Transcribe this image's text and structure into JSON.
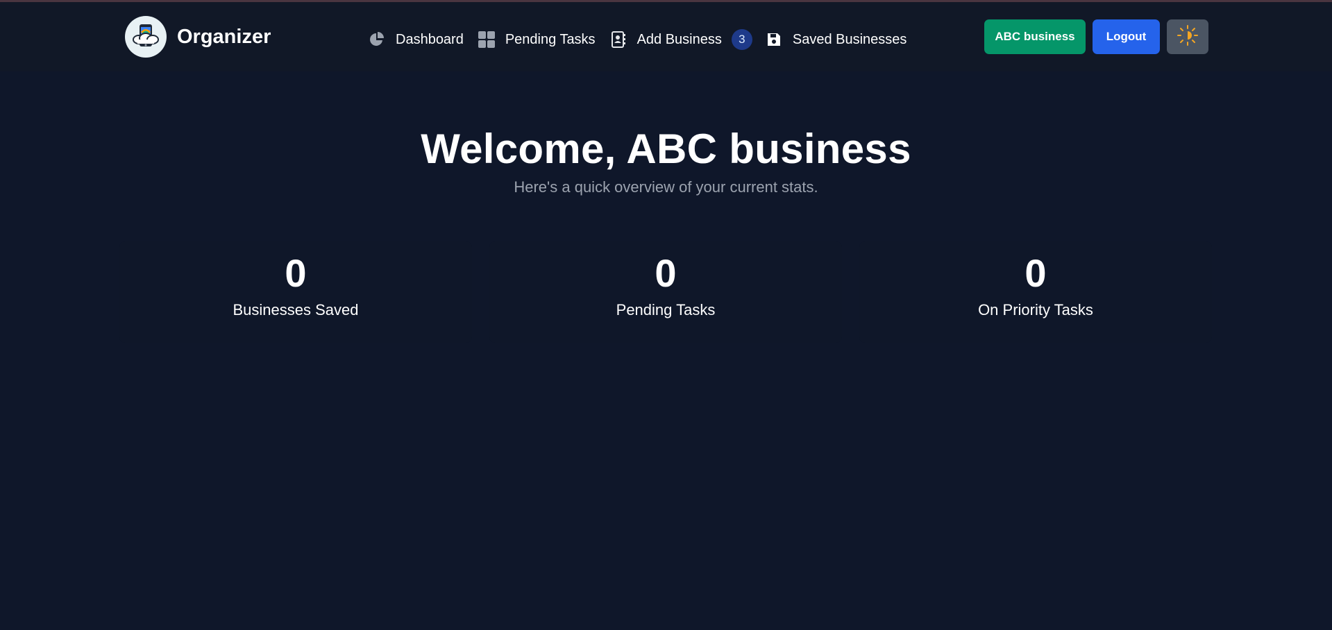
{
  "brand": {
    "name": "Organizer",
    "logo_icon": "phone-cloud-logo"
  },
  "nav": {
    "items": [
      {
        "label": "Dashboard",
        "icon": "pie-chart-icon"
      },
      {
        "label": "Pending Tasks",
        "icon": "grid-icon"
      },
      {
        "label": "Add Business",
        "icon": "contact-book-icon",
        "badge": "3"
      },
      {
        "label": "Saved Businesses",
        "icon": "floppy-disk-icon"
      }
    ]
  },
  "actions": {
    "user_label": "ABC business",
    "logout_label": "Logout",
    "theme_icon": "sun-icon"
  },
  "hero": {
    "title": "Welcome, ABC business",
    "subtitle": "Here's a quick overview of your current stats."
  },
  "stats": [
    {
      "value": "0",
      "label": "Businesses Saved"
    },
    {
      "value": "0",
      "label": "Pending Tasks"
    },
    {
      "value": "0",
      "label": "On Priority Tasks"
    }
  ],
  "colors": {
    "background": "#0f172a",
    "navbar": "#111827",
    "user_button": "#059669",
    "logout_button": "#2563eb",
    "theme_button": "#4b5563",
    "badge": "#1e3a8a",
    "sun": "#f5a623"
  }
}
